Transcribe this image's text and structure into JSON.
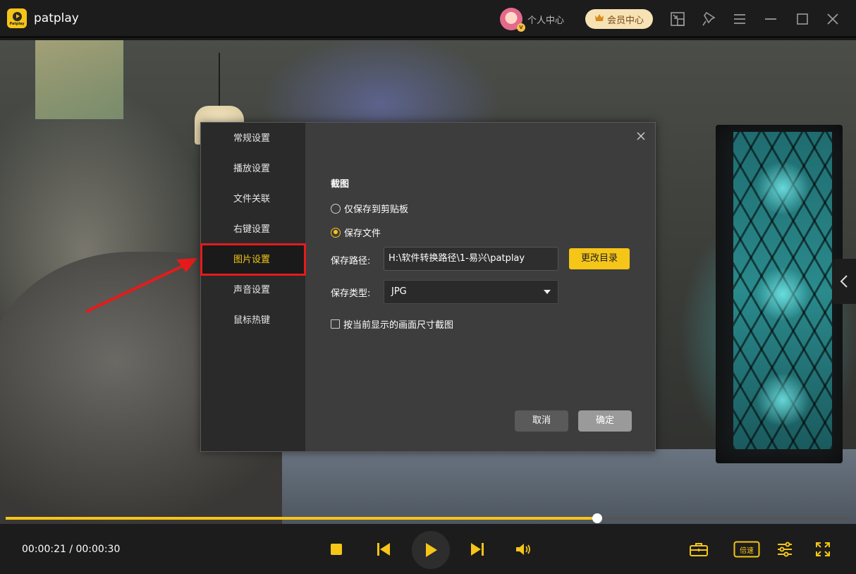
{
  "app": {
    "title": "patplay",
    "logo_text": "Patplay"
  },
  "header": {
    "profile_label": "个人中心",
    "vip_label": "会员中心",
    "vip_badge": "V"
  },
  "settings_dialog": {
    "nav": [
      {
        "label": "常规设置"
      },
      {
        "label": "播放设置"
      },
      {
        "label": "文件关联"
      },
      {
        "label": "右键设置"
      },
      {
        "label": "图片设置",
        "active": true
      },
      {
        "label": "声音设置"
      },
      {
        "label": "鼠标热键"
      }
    ],
    "section_title": "截图",
    "option_clipboard": "仅保存到剪贴板",
    "option_save_file": "保存文件",
    "selected_option": "保存文件",
    "save_path_label": "保存路径:",
    "save_path_value": "H:\\软件转换路径\\1-易兴\\patplay",
    "change_dir_button": "更改目录",
    "save_type_label": "保存类型:",
    "save_type_value": "JPG",
    "checkbox_label": "按当前显示的画面尺寸截图",
    "checkbox_checked": false,
    "cancel_button": "取消",
    "ok_button": "确定"
  },
  "player": {
    "current_time": "00:00:21",
    "total_time": "00:00:30",
    "time_display": "00:00:21 / 00:00:30",
    "progress_fraction": 0.7,
    "speed_label": "倍速"
  },
  "colors": {
    "accent": "#f5c518",
    "highlight": "#e51b1b"
  }
}
